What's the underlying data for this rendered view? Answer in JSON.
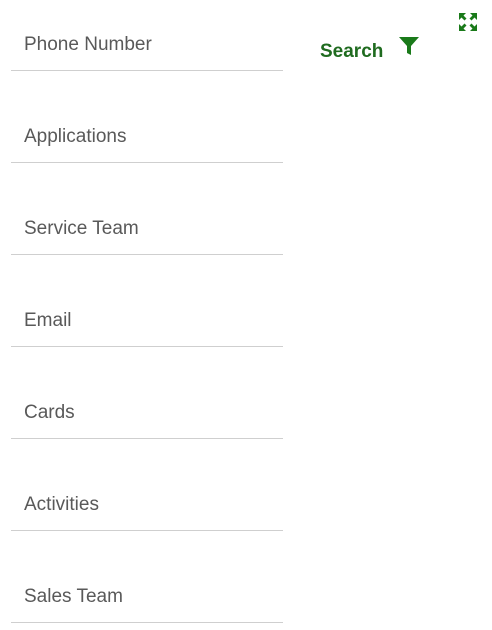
{
  "nav": {
    "items": [
      {
        "label": "Phone Number"
      },
      {
        "label": "Applications"
      },
      {
        "label": "Service Team"
      },
      {
        "label": "Email"
      },
      {
        "label": "Cards"
      },
      {
        "label": "Activities"
      },
      {
        "label": "Sales Team"
      }
    ]
  },
  "toolbar": {
    "search_label": "Search",
    "filter_icon": "filter-icon",
    "expand_icon": "expand-icon"
  },
  "colors": {
    "accent": "#1f6b1f",
    "icon_green": "#1a7a1a",
    "divider": "#cfcfcf",
    "text": "#595959"
  }
}
